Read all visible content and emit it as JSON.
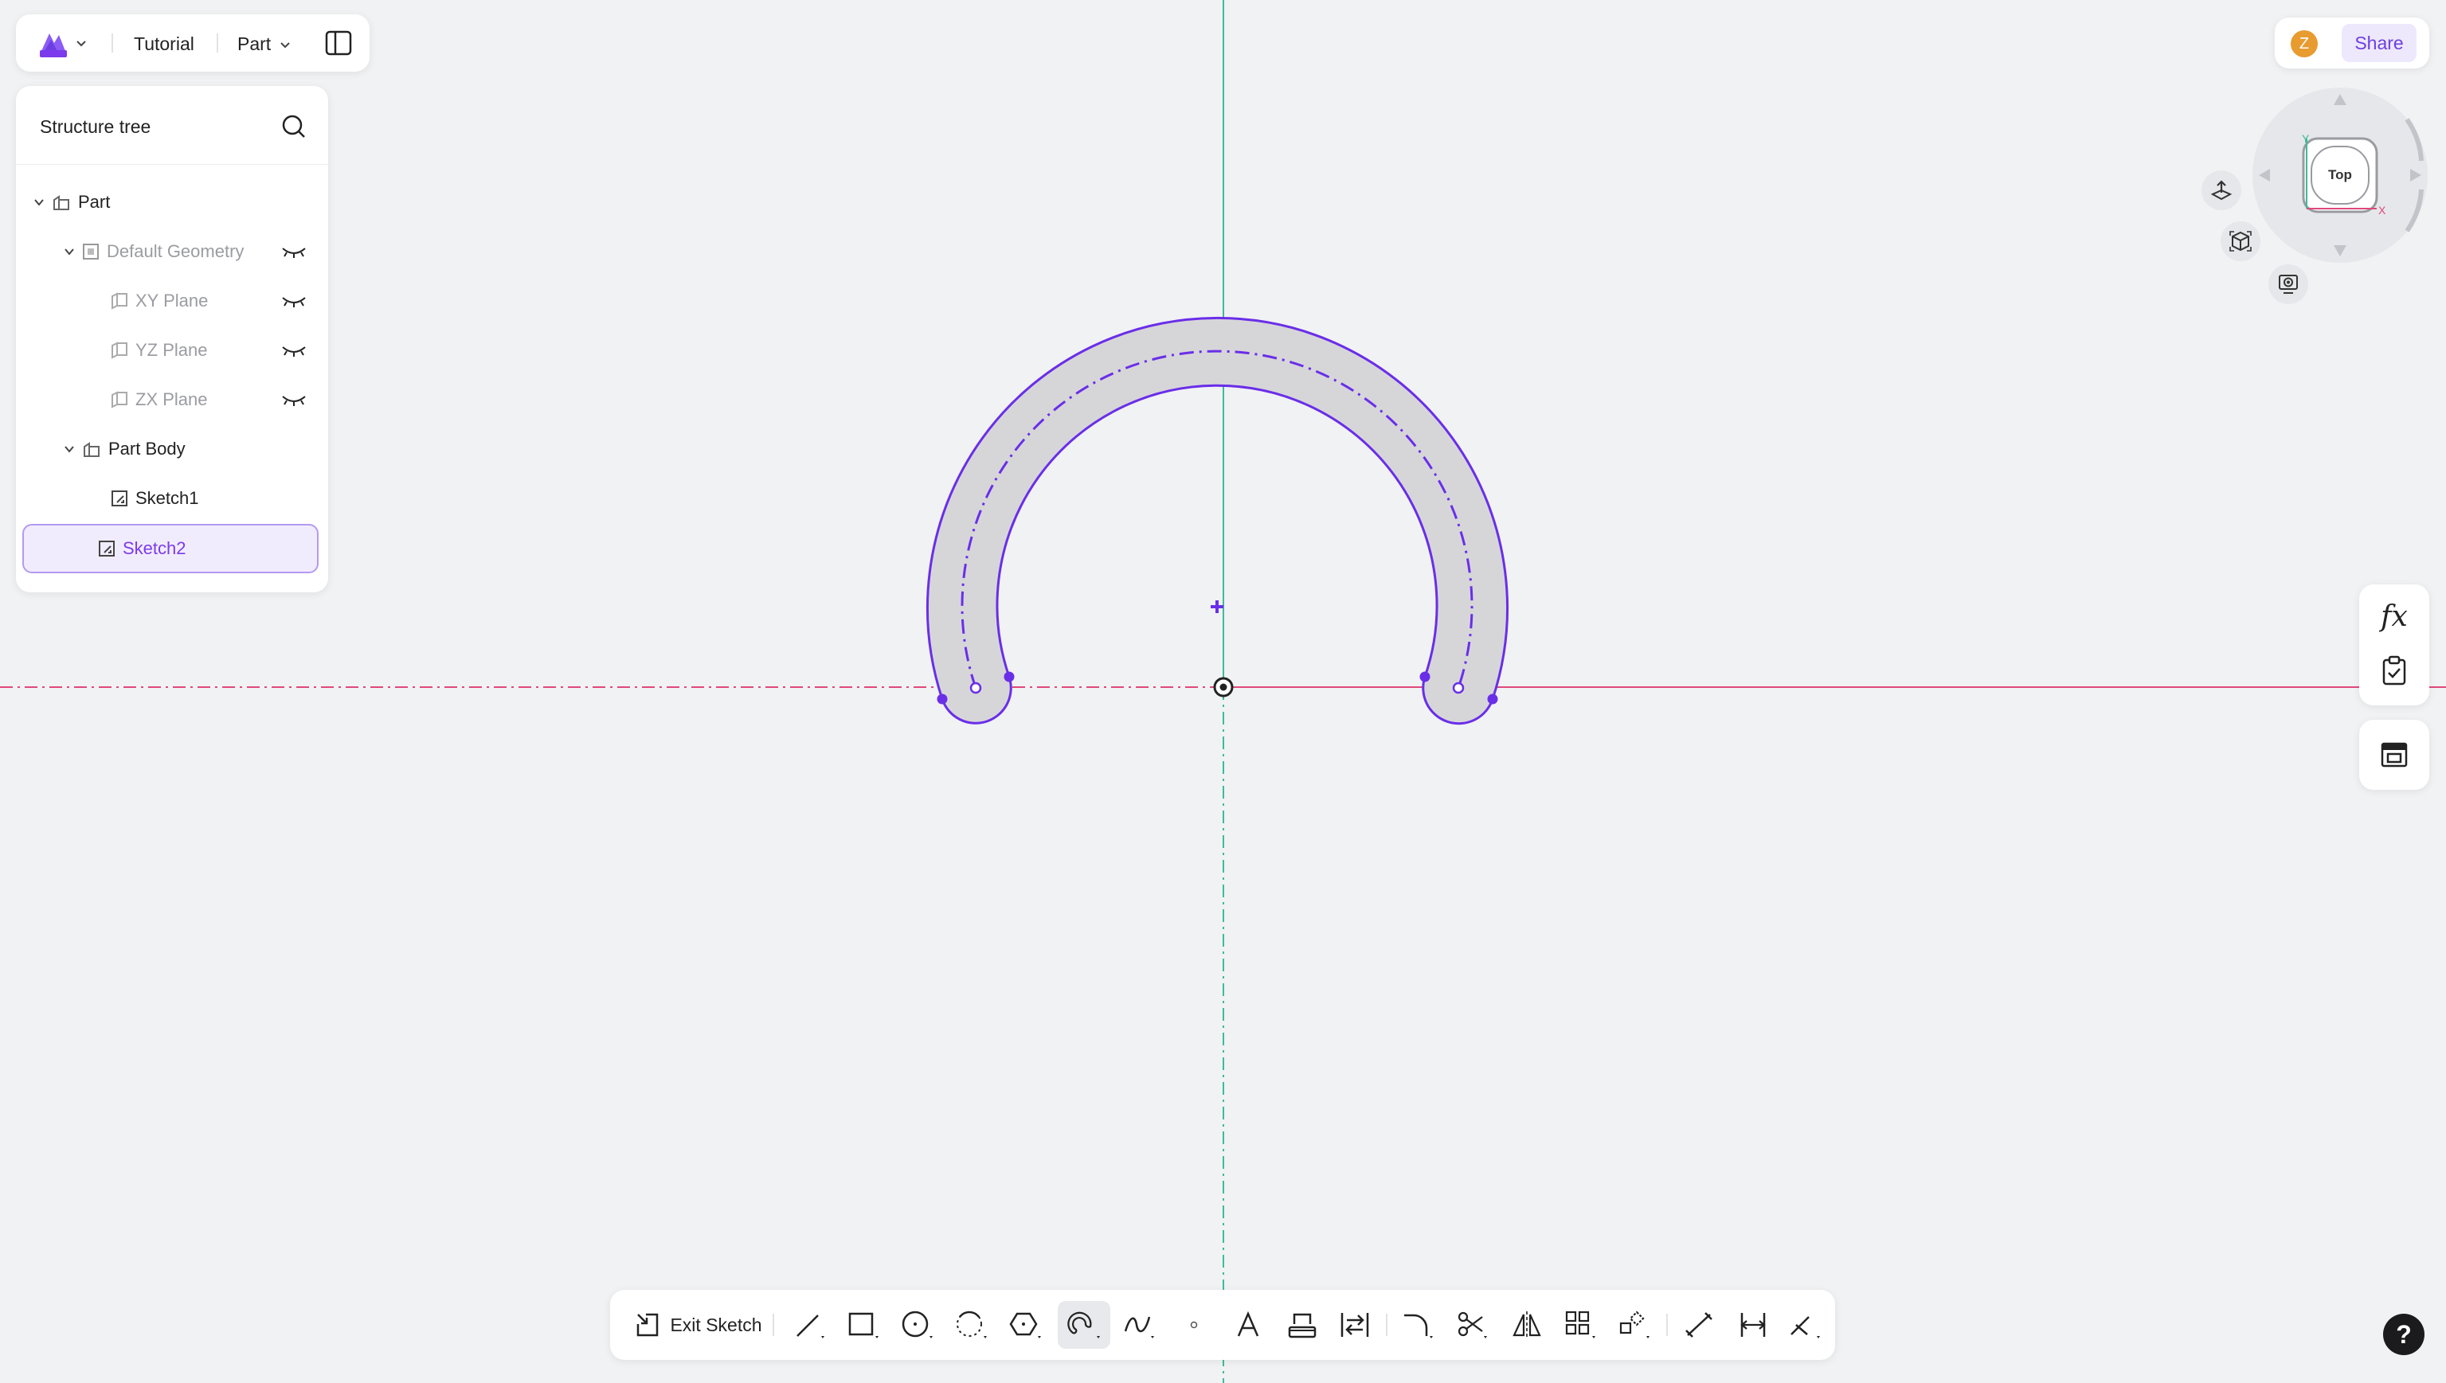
{
  "header": {
    "project": "Tutorial",
    "mode": "Part"
  },
  "tree": {
    "title": "Structure tree",
    "items": [
      {
        "label": "Part"
      },
      {
        "label": "Default Geometry"
      },
      {
        "label": "XY Plane"
      },
      {
        "label": "YZ Plane"
      },
      {
        "label": "ZX Plane"
      },
      {
        "label": "Part Body"
      },
      {
        "label": "Sketch1"
      },
      {
        "label": "Sketch2"
      }
    ]
  },
  "share": {
    "avatar_initial": "Z",
    "label": "Share"
  },
  "navcube": {
    "face": "Top",
    "axis_y": "Y",
    "axis_x": "X"
  },
  "right_tools": {
    "fx": "fx"
  },
  "toolbar": {
    "exit_label": "Exit Sketch"
  },
  "help": {
    "label": "?"
  },
  "colors": {
    "accent": "#7c3aed",
    "sketch_stroke": "#6a2ee8",
    "profile_fill": "#d6d6d9",
    "x_axis": "#e0487a",
    "y_axis": "#3dbb9b"
  }
}
